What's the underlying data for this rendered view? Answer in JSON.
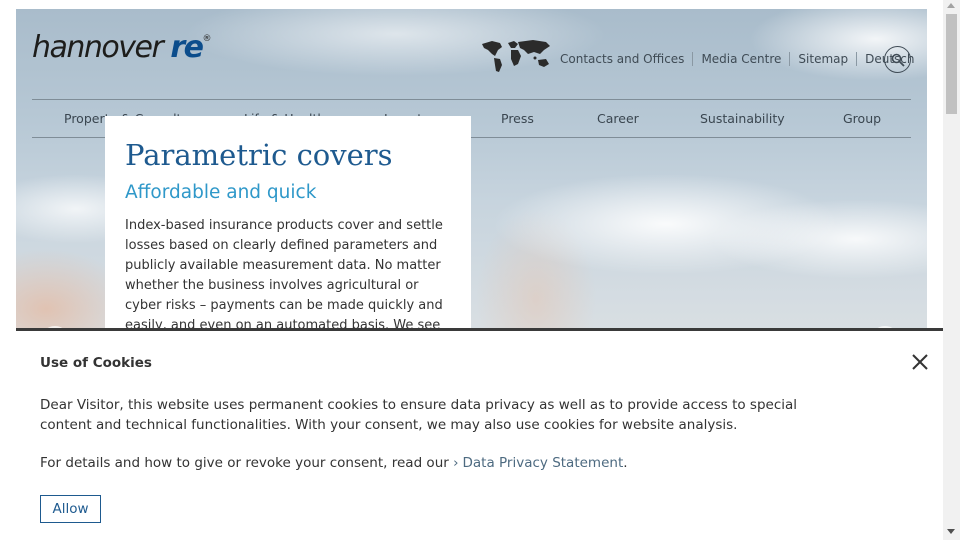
{
  "header": {
    "logo_text": "hannover",
    "logo_re": "re",
    "logo_reg": "®",
    "utility_nav": [
      "Contacts and Offices",
      "Media Centre",
      "Sitemap",
      "Deutsch"
    ],
    "world_icon": "world-map-icon",
    "search_icon": "search-icon"
  },
  "main_nav": {
    "items": [
      "Property & Casualty",
      "Life & Health",
      "Investors",
      "Press",
      "Career",
      "Sustainability",
      "Group"
    ]
  },
  "hero": {
    "title": "Parametric covers",
    "subtitle": "Affordable and quick",
    "body": "Index-based insurance products cover and settle losses based on clearly defined parameters and publicly available measurement data. No matter whether the business involves agricultural or cyber risks – payments can be made quickly and easily, and even on an automated basis. We see"
  },
  "cookie_banner": {
    "title": "Use of Cookies",
    "text": "Dear Visitor, this website uses permanent cookies to ensure data privacy as well as to provide access to special content and technical functionalities. With your consent, we may also use cookies for website analysis.",
    "details_prefix": "For details and how to give or revoke your consent, read our",
    "details_link": "Data Privacy Statement",
    "details_suffix": ".",
    "allow_label": "Allow",
    "close_icon": "close-icon"
  },
  "colors": {
    "brand_blue": "#1e5a8f",
    "accent_blue": "#2f98c9"
  }
}
